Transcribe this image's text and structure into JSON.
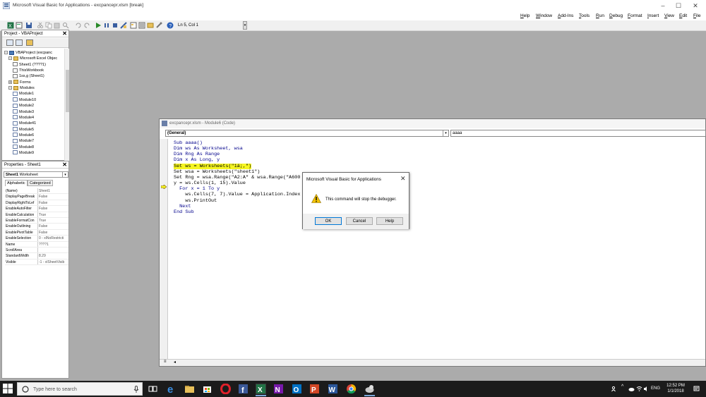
{
  "window": {
    "title": "Microsoft Visual Basic for Applications - excpancepr.xlsm [break]",
    "controls": [
      "–",
      "☐",
      "✕"
    ]
  },
  "menu": [
    "Help",
    "Window",
    "Add-Ins",
    "Tools",
    "Run",
    "Debug",
    "Format",
    "Insert",
    "View",
    "Edit",
    "File"
  ],
  "toolbar": {
    "position": "Ln 5, Col 1"
  },
  "project": {
    "title": "Project - VBAProject",
    "tree": [
      {
        "label": "VBAProject (excpanc",
        "indent": 0,
        "icon": "book",
        "expander": "-"
      },
      {
        "label": "Microsoft Excel Objec",
        "indent": 1,
        "icon": "folder",
        "expander": "-"
      },
      {
        "label": "Sheet1 (????1)",
        "indent": 2,
        "icon": "sheet"
      },
      {
        "label": "ThisWorkbook",
        "indent": 2,
        "icon": "sheet"
      },
      {
        "label": "1ss,g (Sheet1)",
        "indent": 2,
        "icon": "sheet"
      },
      {
        "label": "Forms",
        "indent": 1,
        "icon": "folder",
        "expander": "+"
      },
      {
        "label": "Modules",
        "indent": 1,
        "icon": "folder",
        "expander": "-"
      },
      {
        "label": "Module1",
        "indent": 2,
        "icon": "module"
      },
      {
        "label": "Module10",
        "indent": 2,
        "icon": "module"
      },
      {
        "label": "Module2",
        "indent": 2,
        "icon": "module"
      },
      {
        "label": "Module3",
        "indent": 2,
        "icon": "module"
      },
      {
        "label": "Module4",
        "indent": 2,
        "icon": "module"
      },
      {
        "label": "Module41",
        "indent": 2,
        "icon": "module"
      },
      {
        "label": "Module5",
        "indent": 2,
        "icon": "module"
      },
      {
        "label": "Module6",
        "indent": 2,
        "icon": "module"
      },
      {
        "label": "Module7",
        "indent": 2,
        "icon": "module"
      },
      {
        "label": "Module8",
        "indent": 2,
        "icon": "module"
      },
      {
        "label": "Module9",
        "indent": 2,
        "icon": "module"
      }
    ]
  },
  "properties": {
    "title": "Properties - Sheet1",
    "object_name": "Sheet1",
    "object_type": "Worksheet",
    "tabs": [
      "Alphabetic",
      "Categorized"
    ],
    "rows": [
      {
        "name": "(Name)",
        "value": "Sheet1"
      },
      {
        "name": "DisplayPageBreak",
        "value": "False"
      },
      {
        "name": "DisplayRightToLef",
        "value": "False"
      },
      {
        "name": "EnableAutoFilter",
        "value": "False"
      },
      {
        "name": "EnableCalculation",
        "value": "True"
      },
      {
        "name": "EnableFormatCon",
        "value": "True"
      },
      {
        "name": "EnableOutlining",
        "value": "False"
      },
      {
        "name": "EnablePivotTable",
        "value": "False"
      },
      {
        "name": "EnableSelection",
        "value": "0 - xlNoRestricti"
      },
      {
        "name": "Name",
        "value": "????1"
      },
      {
        "name": "ScrollArea",
        "value": ""
      },
      {
        "name": "StandardWidth",
        "value": "8.29"
      },
      {
        "name": "Visible",
        "value": "-1 - xlSheetVisib"
      }
    ]
  },
  "code_window": {
    "title": "excpancepr.xlsm - Module6 (Code)",
    "object_combo": "(General)",
    "procedure_combo": "aaaa",
    "lines": [
      {
        "text": "Sub aaaa()",
        "kw": true
      },
      {
        "text": "Dim ws As Worksheet, wsa",
        "kw": true
      },
      {
        "text": "Dim Rng As Range",
        "kw": true
      },
      {
        "text": "Dim x As Long, y",
        "kw": true
      },
      {
        "text": "Set ws = Worksheets(\"1ä;,\")",
        "highlight": true
      },
      {
        "text": "Set wsa = Worksheets(\"sheet1\")"
      },
      {
        "text": "Set Rng = wsa.Range(\"A2:A\" & wsa.Range(\"A600"
      },
      {
        "text": "y = ws.Cells(1, 15).Value"
      },
      {
        "text": "  For x = 1 To y",
        "kw": true
      },
      {
        "text": "    ws.Cells(7, 7).Value = Application.Index"
      },
      {
        "text": "    ws.PrintOut"
      },
      {
        "text": "  Next",
        "kw": true
      },
      {
        "text": "End Sub",
        "kw": true
      }
    ]
  },
  "dialog": {
    "title": "Microsoft Visual Basic for Applications",
    "message": "This command will stop the debugger.",
    "ok": "OK",
    "cancel": "Cancel",
    "help": "Help"
  },
  "taskbar": {
    "search_placeholder": "Type here to search",
    "language": "ENG",
    "time": "12:52 PM",
    "date": "1/1/2018"
  },
  "colors": {
    "highlight": "#f5f522",
    "keyword": "#00008b",
    "taskbar": "#1b1b1b"
  }
}
